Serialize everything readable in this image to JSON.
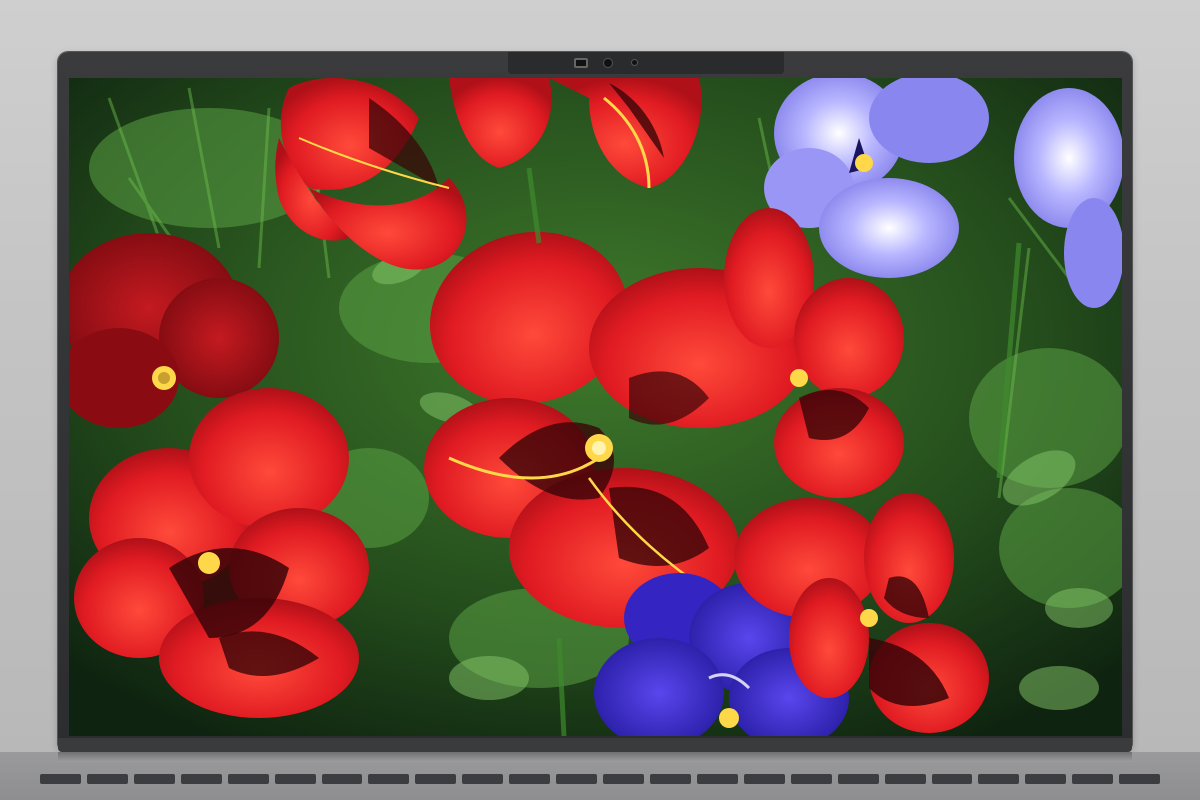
{
  "photo": {
    "subject": "flowers",
    "colors": {
      "bezel": "#2e2f31",
      "foliage_dark": "#1a3a15",
      "foliage_light": "#4f8f3a",
      "red_petal": "#e8222a",
      "dark_red_center": "#3a0508",
      "violet_petal": "#8a86ef",
      "blue_petal": "#3a2ac9",
      "yellow_eye": "#ffd84a"
    }
  },
  "device": {
    "keyboard_keys": 24
  }
}
